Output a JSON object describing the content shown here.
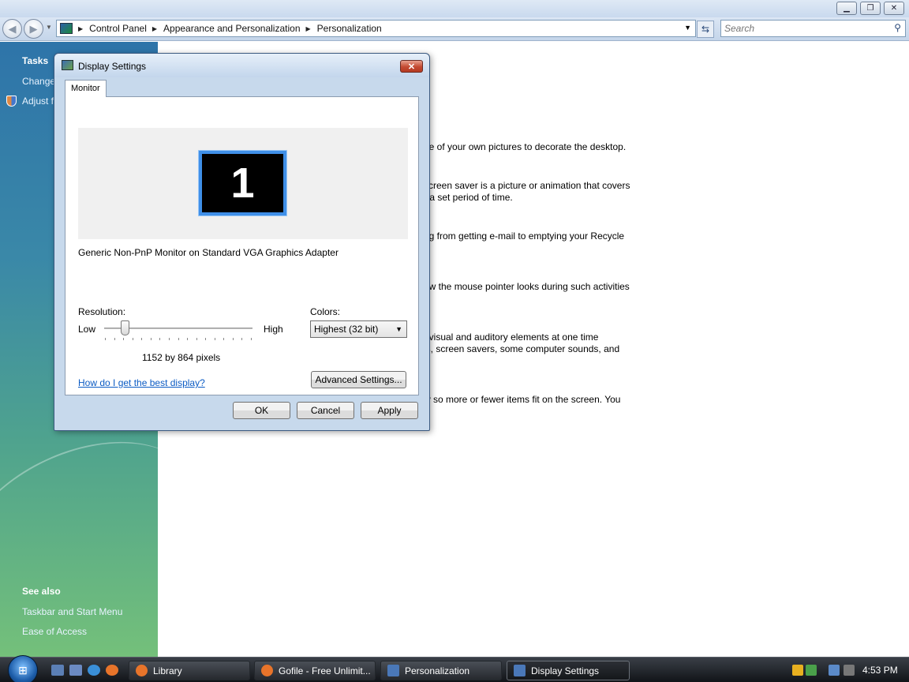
{
  "window": {
    "breadcrumbs": [
      "Control Panel",
      "Appearance and Personalization",
      "Personalization"
    ],
    "search_placeholder": "Search"
  },
  "left_pane": {
    "tasks_heading": "Tasks",
    "tasks": [
      "Change",
      "Adjust f"
    ],
    "see_also_heading": "See also",
    "see_also": [
      "Taskbar and Start Menu",
      "Ease of Access"
    ]
  },
  "content": {
    "lines": [
      "ne of your own pictures to decorate the desktop.",
      "screen saver is a picture or animation that covers",
      "r a set period of time.",
      "ng from getting e-mail to emptying your Recycle",
      "ow the mouse pointer looks during such activities",
      "f visual and auditory elements at one time",
      "ls, screen savers, some computer sounds, and",
      "w so more or fewer items fit on the screen. You"
    ]
  },
  "dialog": {
    "title": "Display Settings",
    "close_glyph": "✕",
    "tab": "Monitor",
    "monitor_number": "1",
    "monitor_description": "Generic Non-PnP Monitor on Standard VGA Graphics Adapter",
    "resolution_label": "Resolution:",
    "low_label": "Low",
    "high_label": "High",
    "resolution_value": "1152 by 864 pixels",
    "resolution_slider_fraction": 0.12,
    "colors_label": "Colors:",
    "colors_value": "Highest (32 bit)",
    "help_link": "How do I get the best display?",
    "advanced_button": "Advanced Settings...",
    "ok_button": "OK",
    "cancel_button": "Cancel",
    "apply_button": "Apply"
  },
  "taskbar": {
    "buttons": [
      "Library",
      "Gofile - Free Unlimit...",
      "Personalization",
      "Display Settings"
    ],
    "active_button": "Display Settings",
    "clock": "4:53 PM"
  },
  "colors": {
    "link": "#0b5bc4",
    "monitor_border": "#3f8fe8",
    "close_red": "#c44a32"
  }
}
